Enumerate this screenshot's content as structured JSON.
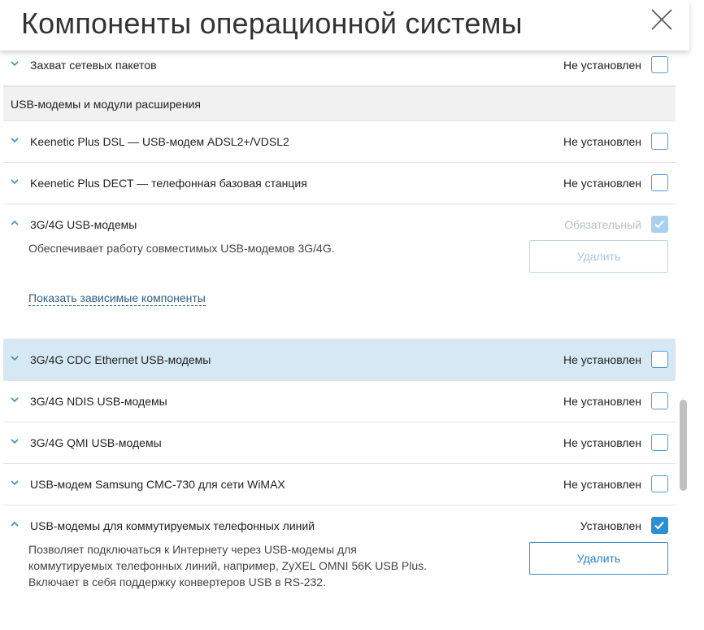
{
  "dialog": {
    "title": "Компоненты операционной системы",
    "close_icon": "close-icon"
  },
  "colors": {
    "accent": "#2b8fd6",
    "active_row": "#d6e8f3",
    "section_bg": "#f1f1f1"
  },
  "rows_top": [
    {
      "label": "Захват сетевых пакетов",
      "status": "Не установлен",
      "checked": false
    }
  ],
  "section": {
    "label": "USB-модемы и модули расширения"
  },
  "rows_a": [
    {
      "label": "Keenetic Plus DSL — USB-модем ADSL2+/VDSL2",
      "status": "Не установлен",
      "checked": false
    },
    {
      "label": "Keenetic Plus DECT — телефонная базовая станция",
      "status": "Не установлен",
      "checked": false
    }
  ],
  "expanded_1": {
    "label": "3G/4G USB-модемы",
    "status": "Обязательный",
    "checked": true,
    "disabled": true,
    "description": "Обеспечивает работу совместимых USB-модемов 3G/4G.",
    "delete_label": "Удалить",
    "dependencies_link": "Показать зависимые компоненты"
  },
  "rows_b": [
    {
      "label": "3G/4G CDC Ethernet USB-модемы",
      "status": "Не установлен",
      "checked": false,
      "active": true
    },
    {
      "label": "3G/4G NDIS USB-модемы",
      "status": "Не установлен",
      "checked": false
    },
    {
      "label": "3G/4G QMI USB-модемы",
      "status": "Не установлен",
      "checked": false
    },
    {
      "label": "USB-модем Samsung CMC-730 для сети WiMAX",
      "status": "Не установлен",
      "checked": false
    }
  ],
  "expanded_2": {
    "label": "USB-модемы для коммутируемых телефонных линий",
    "status": "Установлен",
    "checked": true,
    "description_lines": [
      "Позволяет подключаться к Интернету через USB-модемы для",
      "коммутируемых телефонных линий, например, ZyXEL OMNI 56K USB Plus.",
      "Включает в себя поддержку конвертеров USB в RS-232."
    ],
    "delete_label": "Удалить"
  }
}
